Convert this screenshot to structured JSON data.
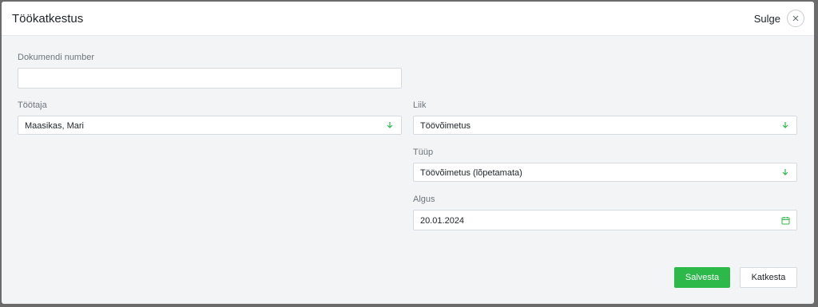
{
  "dialog": {
    "title": "Töökatkestus",
    "close_label": "Sulge"
  },
  "form": {
    "document_number": {
      "label": "Dokumendi number",
      "value": ""
    },
    "employee": {
      "label": "Töötaja",
      "value": "Maasikas, Mari"
    },
    "kind": {
      "label": "Liik",
      "value": "Töövõimetus"
    },
    "type": {
      "label": "Tüüp",
      "value": "Töövõimetus (lõpetamata)"
    },
    "start": {
      "label": "Algus",
      "value": "20.01.2024"
    }
  },
  "actions": {
    "save_label": "Salvesta",
    "cancel_label": "Katkesta"
  },
  "colors": {
    "accent": "#2db84a",
    "icon_green": "#2db84a"
  },
  "icons": {
    "close": "close-icon",
    "dropdown": "chevron-down-icon",
    "calendar": "calendar-icon"
  }
}
